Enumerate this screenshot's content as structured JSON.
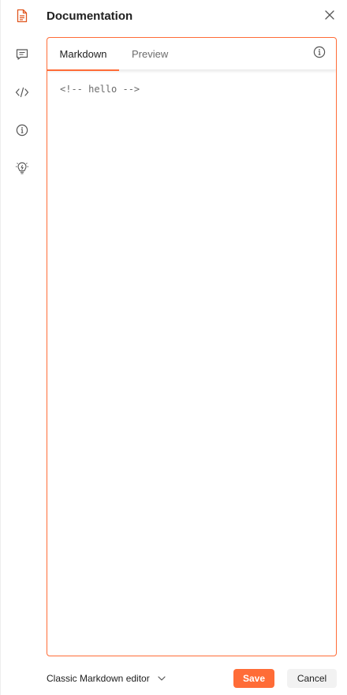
{
  "rail": {
    "items": [
      {
        "icon": "documentation-icon",
        "active": true
      },
      {
        "icon": "comments-icon",
        "active": false
      },
      {
        "icon": "code-icon",
        "active": false
      },
      {
        "icon": "info-icon",
        "active": false
      },
      {
        "icon": "lightbulb-icon",
        "active": false
      }
    ]
  },
  "panel": {
    "title": "Documentation",
    "close_icon": "close-icon"
  },
  "editor": {
    "tabs": [
      {
        "label": "Markdown",
        "active": true
      },
      {
        "label": "Preview",
        "active": false
      }
    ],
    "info_icon": "info-icon",
    "content": "<!-- hello -->"
  },
  "footer": {
    "mode_label": "Classic Markdown editor",
    "save_label": "Save",
    "cancel_label": "Cancel"
  },
  "colors": {
    "accent": "#ff6c37",
    "text": "#212121",
    "muted": "#6b6b6b",
    "cancel_bg": "#f2f2f2"
  }
}
